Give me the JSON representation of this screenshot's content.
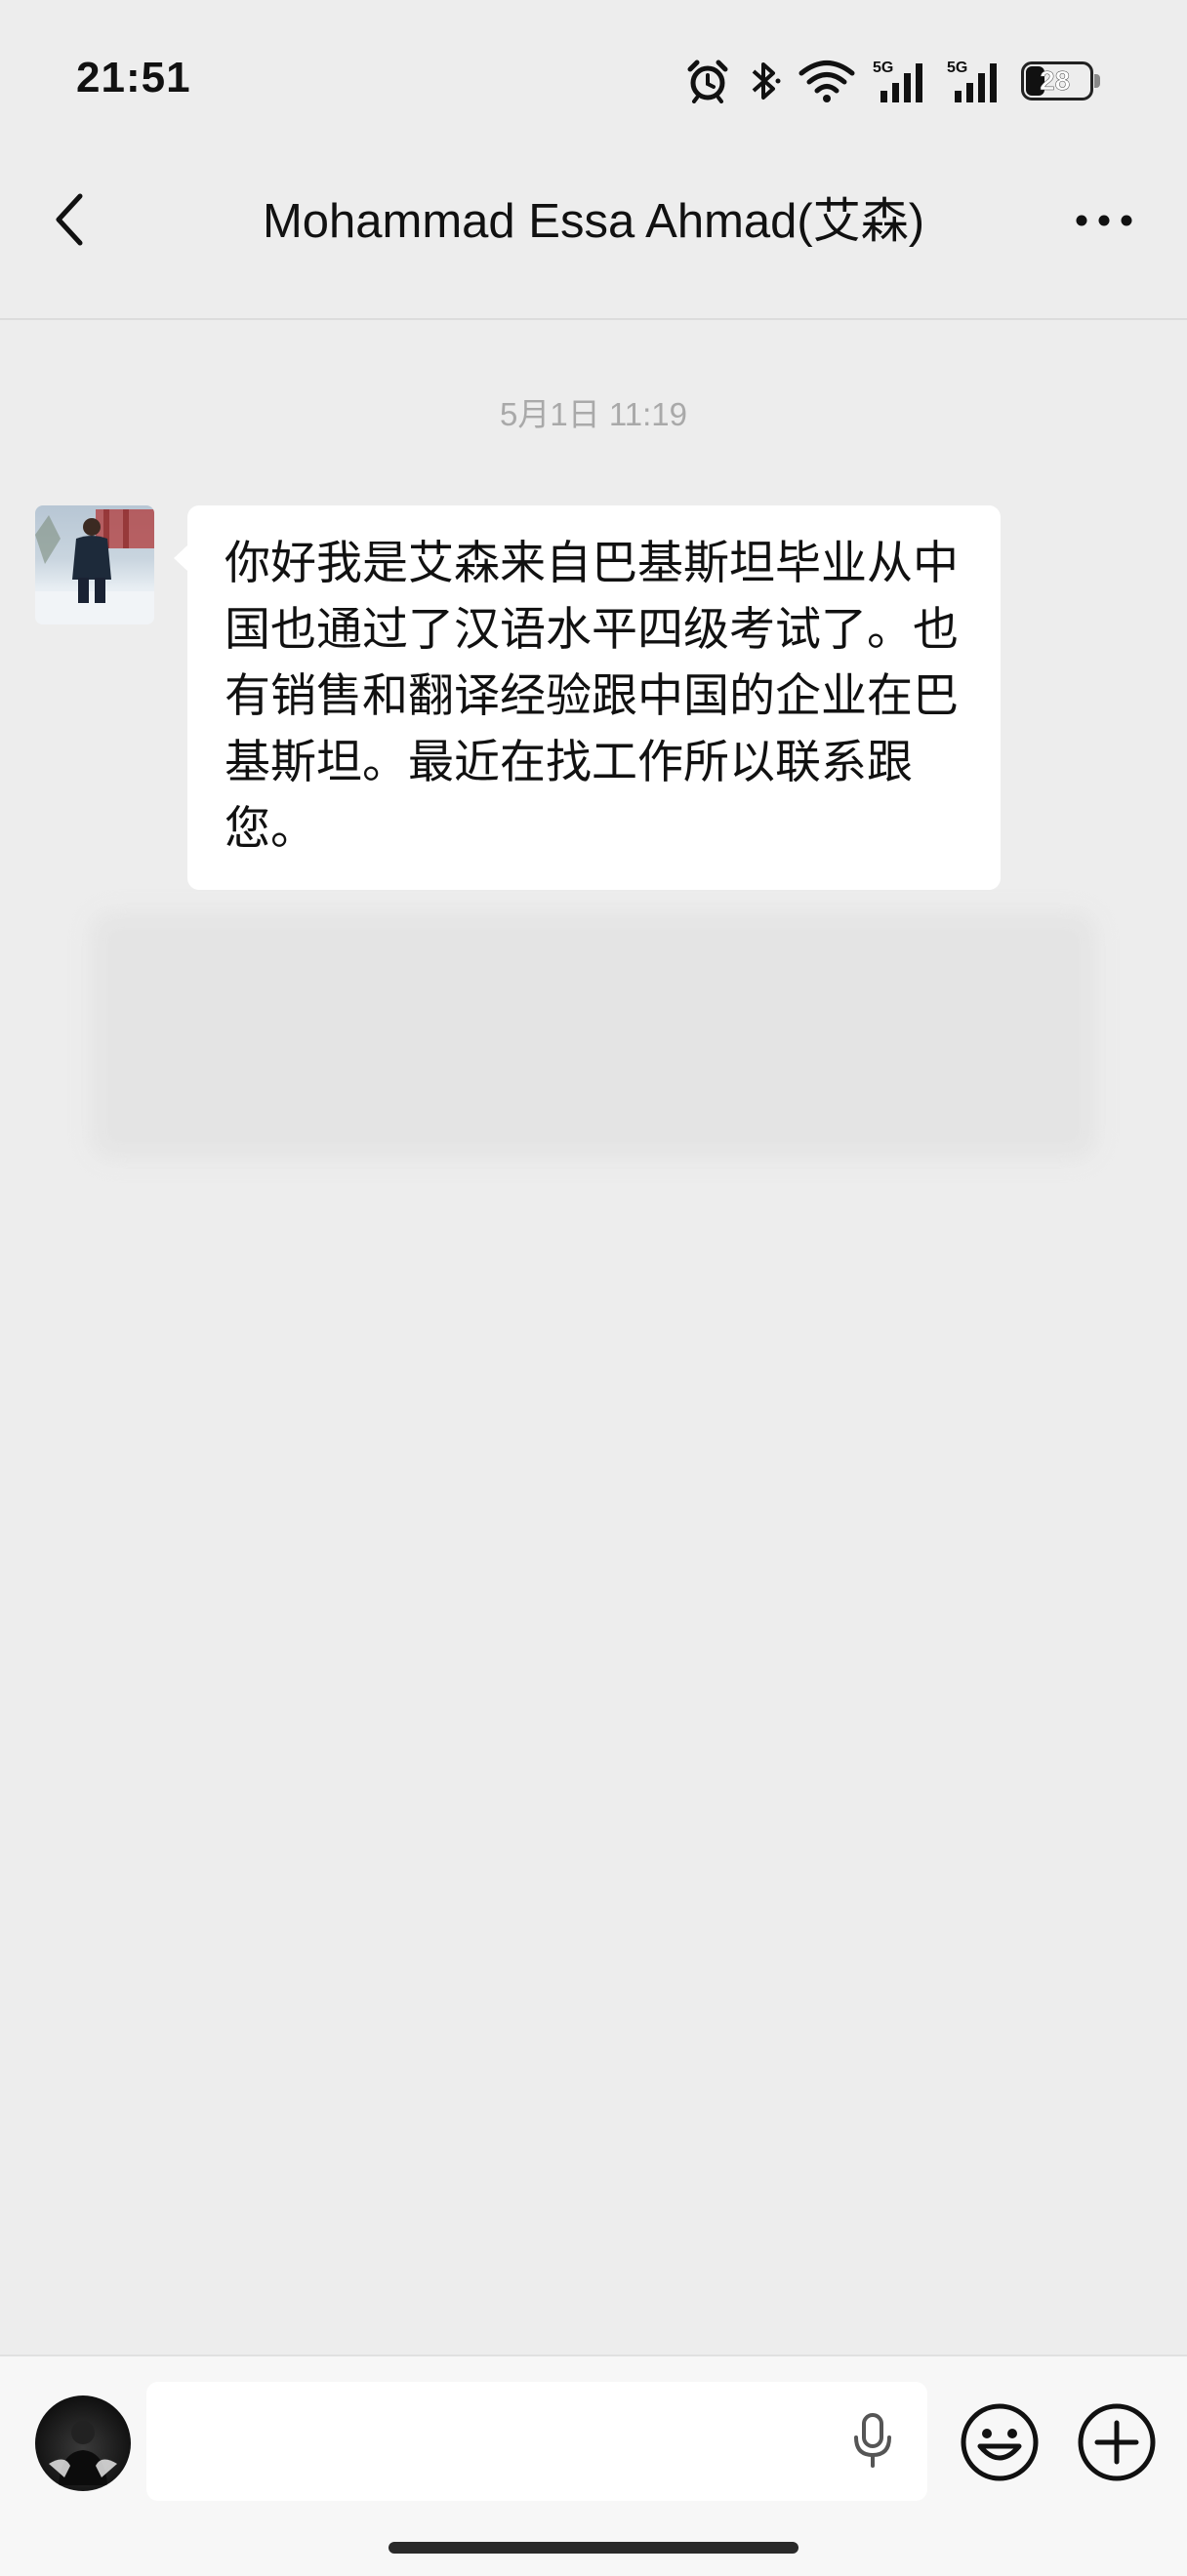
{
  "status_bar": {
    "time": "21:51",
    "network_1": "5G",
    "network_2": "5G",
    "battery_level": "28",
    "icons": [
      "alarm-icon",
      "bluetooth-icon",
      "wifi-icon",
      "signal-icon",
      "signal-icon",
      "battery-icon"
    ]
  },
  "nav": {
    "title": "Mohammad Essa Ahmad(艾森)",
    "back_icon": "chevron-left-icon",
    "more_icon": "more-dots-icon"
  },
  "chat": {
    "timestamp": "5月1日 11:19",
    "messages": [
      {
        "text": "你好我是艾森来自巴基斯坦毕业从中国也通过了汉语水平四级考试了。也有销售和翻译经验跟中国的企业在巴基斯坦。最近在找工作所以联系跟您。",
        "avatar": "contact-avatar"
      }
    ]
  },
  "input_bar": {
    "placeholder": "",
    "mic_icon": "microphone-icon",
    "emoji_icon": "emoji-icon",
    "plus_icon": "plus-circle-icon"
  },
  "colors": {
    "background": "#ededed",
    "bubble": "#ffffff",
    "timestamp": "#a9a9a9",
    "text": "#111111"
  }
}
